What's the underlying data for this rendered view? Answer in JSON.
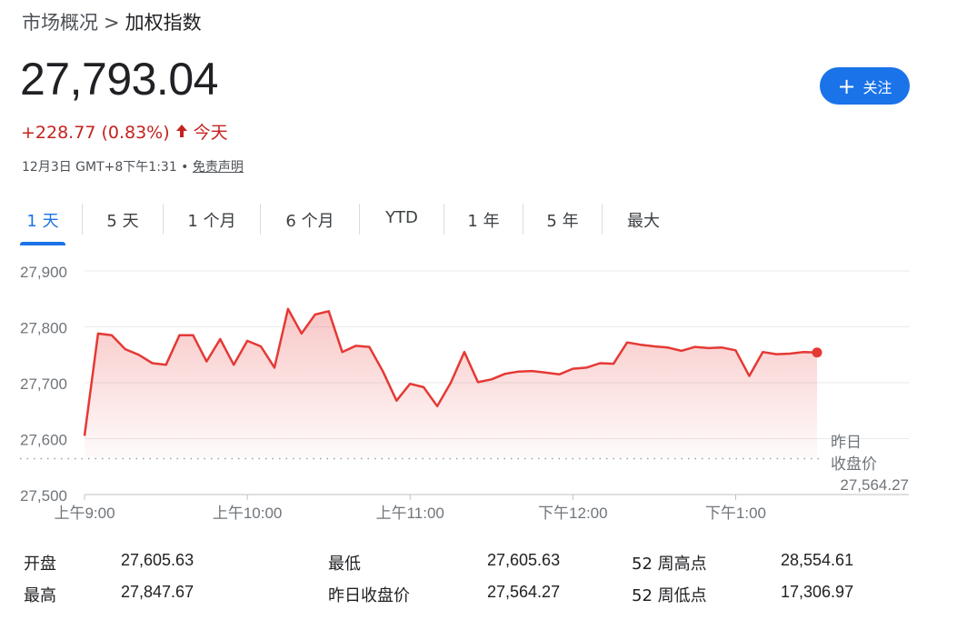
{
  "breadcrumb": {
    "parent": "市场概况",
    "separator": ">",
    "current": "加权指数"
  },
  "price": "27,793.04",
  "change": {
    "text": "+228.77 (0.83%)",
    "period": "今天",
    "color": "#c5221f"
  },
  "timestamp": {
    "text": "12月3日 GMT+8下午1:31 • ",
    "disclaimer": "免责声明"
  },
  "follow_button": {
    "label": "关注",
    "icon": "plus-icon"
  },
  "tabs": [
    "1 天",
    "5 天",
    "1 个月",
    "6 个月",
    "YTD",
    "1 年",
    "5 年",
    "最大"
  ],
  "active_tab": "1 天",
  "colors": {
    "accent": "#1a73e8",
    "line": "#e53935",
    "down_text": "#c5221f"
  },
  "prev_close_label": [
    "昨日",
    "收盘价"
  ],
  "prev_close_value": "27,564.27",
  "chart_data": {
    "type": "line",
    "title": "",
    "xlabel": "",
    "ylabel": "",
    "ylim": [
      27500,
      27900
    ],
    "y_ticks": [
      "27,500",
      "27,600",
      "27,700",
      "27,800",
      "27,900"
    ],
    "x_ticks": [
      {
        "label": "上午9:00",
        "t": 0
      },
      {
        "label": "上午10:00",
        "t": 60
      },
      {
        "label": "上午11:00",
        "t": 120
      },
      {
        "label": "下午12:00",
        "t": 180
      },
      {
        "label": "下午1:00",
        "t": 240
      }
    ],
    "x_range": [
      0,
      270
    ],
    "baseline": 27564.27,
    "grid": true,
    "series": [
      {
        "t": [
          0,
          5,
          10,
          15,
          20,
          25,
          30,
          35,
          40,
          45,
          50,
          55,
          60,
          65,
          70,
          75,
          80,
          85,
          90,
          95,
          100,
          105,
          110,
          115,
          120,
          125,
          130,
          135,
          140,
          145,
          150,
          155,
          160,
          165,
          170,
          175,
          180,
          185,
          190,
          195,
          200,
          205,
          210,
          215,
          220,
          225,
          230,
          235,
          240,
          245,
          250,
          255,
          260,
          265,
          270
        ],
        "values": [
          27605,
          27788,
          27785,
          27760,
          27750,
          27735,
          27732,
          27785,
          27785,
          27738,
          27778,
          27732,
          27775,
          27765,
          27727,
          27832,
          27788,
          27822,
          27828,
          27755,
          27766,
          27764,
          27720,
          27668,
          27698,
          27692,
          27658,
          27700,
          27755,
          27701,
          27706,
          27716,
          27720,
          27721,
          27718,
          27715,
          27725,
          27727,
          27735,
          27734,
          27772,
          27768,
          27765,
          27763,
          27757,
          27764,
          27762,
          27763,
          27758,
          27712,
          27755,
          27751,
          27752,
          27755,
          27754
        ]
      }
    ]
  },
  "stats": [
    {
      "label": "开盘",
      "value": "27,605.63"
    },
    {
      "label": "最高",
      "value": "27,847.67"
    },
    {
      "label": "最低",
      "value": "27,605.63"
    },
    {
      "label": "昨日收盘价",
      "value": "27,564.27"
    },
    {
      "label": "52 周高点",
      "value": "28,554.61"
    },
    {
      "label": "52 周低点",
      "value": "17,306.97"
    }
  ]
}
